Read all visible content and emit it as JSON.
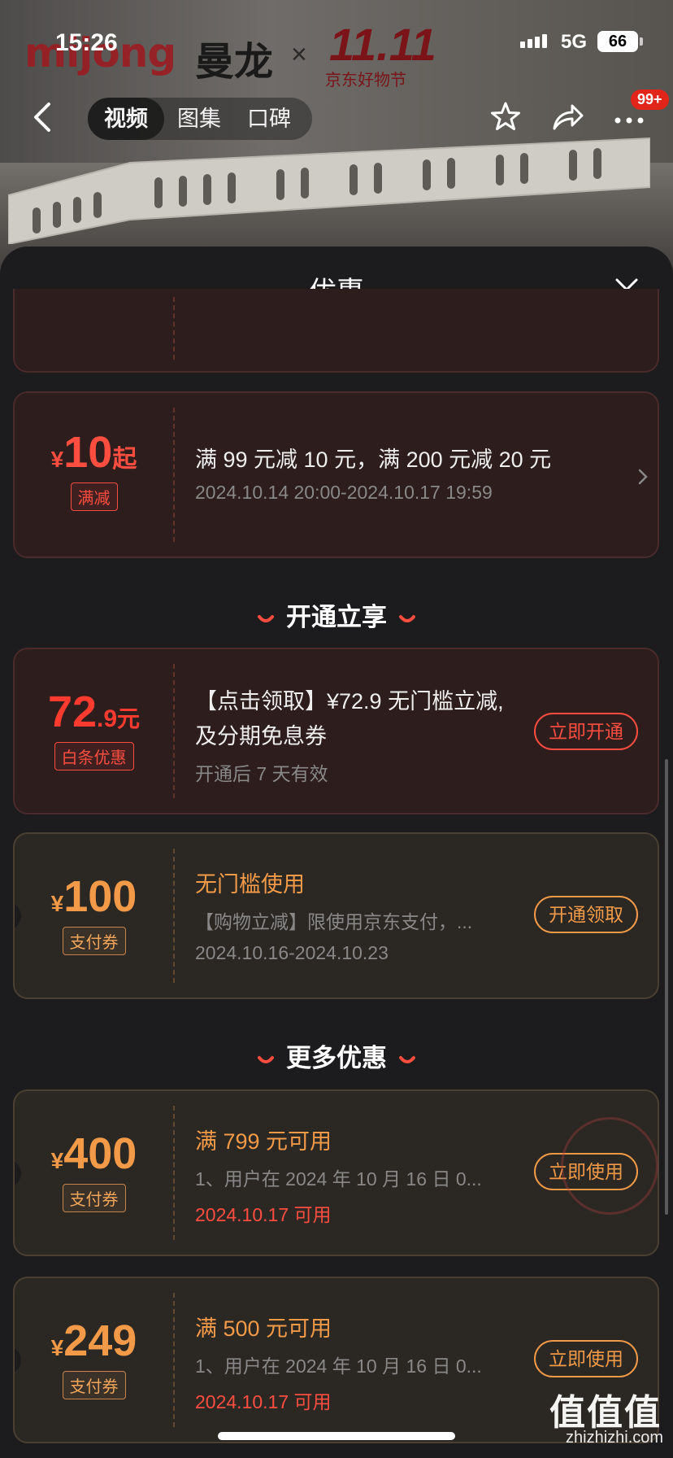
{
  "status_bar": {
    "time": "15:26",
    "network": "5G",
    "battery": "66"
  },
  "banner": {
    "logo": "mijong",
    "brand": "曼龙",
    "x": "×",
    "event": "11.11",
    "event_sub": "京东好物节"
  },
  "nav": {
    "tabs": [
      {
        "label": "视频"
      },
      {
        "label": "图集"
      },
      {
        "label": "口碑"
      }
    ],
    "badge": "99+"
  },
  "sheet": {
    "title": "优惠"
  },
  "coupons": [
    {
      "amount_prefix": "¥",
      "amount": "10",
      "amount_suffix": "起",
      "tag": "满减",
      "title": "满 99 元减 10 元，满 200 元减 20 元",
      "subtitle": "2024.10.14 20:00-2024.10.17 19:59"
    }
  ],
  "sections": {
    "open": "开通立享",
    "more": "更多优惠"
  },
  "open_coupons": [
    {
      "amount": "72",
      "amount_decimal": ".9",
      "amount_unit": "元",
      "tag": "白条优惠",
      "title": "【点击领取】¥72.9 无门槛立减,",
      "title2": "及分期免息券",
      "subtitle": "开通后 7 天有效",
      "button": "立即开通"
    },
    {
      "amount_prefix": "¥",
      "amount": "100",
      "tag": "支付券",
      "title": "无门槛使用",
      "subtitle": "【购物立减】限使用京东支付，...",
      "subtitle2": "2024.10.16-2024.10.23",
      "button": "开通领取"
    }
  ],
  "more_coupons": [
    {
      "amount_prefix": "¥",
      "amount": "400",
      "tag": "支付券",
      "title": "满 799 元可用",
      "subtitle": "1、用户在 2024 年 10 月 16 日 0...",
      "date": "2024.10.17 可用",
      "button": "立即使用"
    },
    {
      "amount_prefix": "¥",
      "amount": "249",
      "tag": "支付券",
      "title": "满 500 元可用",
      "subtitle": "1、用户在 2024 年 10 月 16 日 0...",
      "date": "2024.10.17 可用",
      "button": "立即使用"
    }
  ],
  "watermark": {
    "main": "值值值",
    "sub": "zhizhizhi.com"
  },
  "colors": {
    "accent_red": "#ff4d40",
    "accent_gold": "#f39a48",
    "sheet_bg": "#1c1c1e"
  }
}
